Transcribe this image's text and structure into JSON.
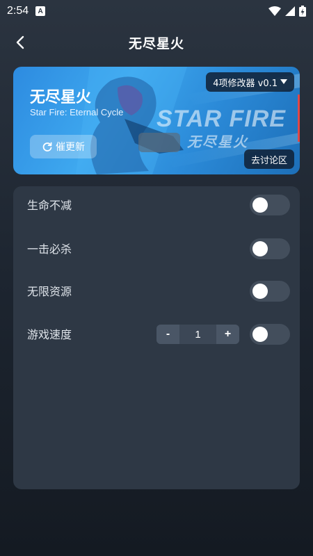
{
  "status_bar": {
    "time": "2:54",
    "notification_icon": "A"
  },
  "header": {
    "title": "无尽星火",
    "back_icon": "chevron-left-icon"
  },
  "banner": {
    "game_name": "无尽星火",
    "subtitle": "Star Fire: Eternal Cycle",
    "urge_update_label": "催更新",
    "version_select_label": "4项修改器 v0.1",
    "discuss_label": "去讨论区",
    "art_logo_en": "STAR FIRE",
    "art_logo_cn": "无尽星火"
  },
  "cheats": [
    {
      "label": "生命不减",
      "enabled": false
    },
    {
      "label": "一击必杀",
      "enabled": false
    },
    {
      "label": "无限资源",
      "enabled": false
    },
    {
      "label": "游戏速度",
      "enabled": false,
      "stepper": {
        "minus": "-",
        "value": "1",
        "plus": "+"
      }
    }
  ]
}
